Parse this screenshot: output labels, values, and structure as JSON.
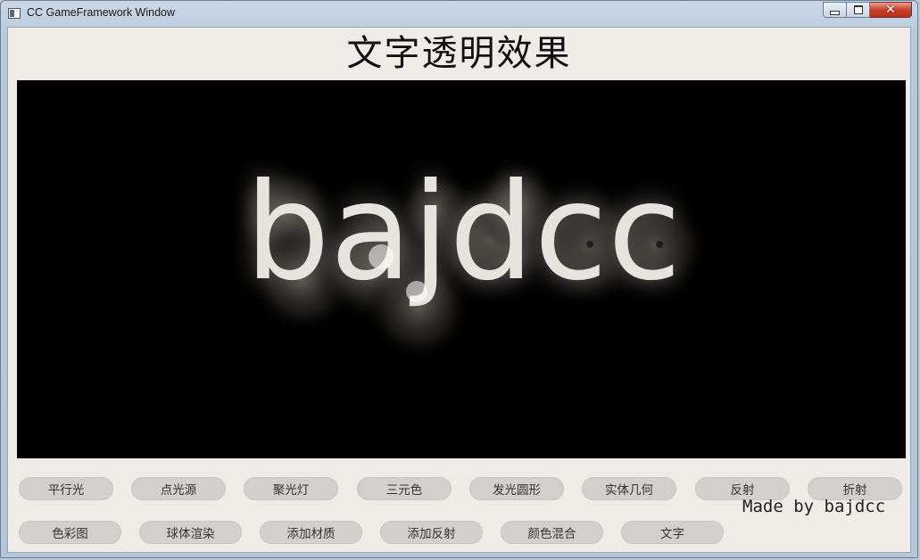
{
  "window": {
    "title": "CC GameFramework Window",
    "close_glyph": "✕"
  },
  "page": {
    "heading": "文字透明效果"
  },
  "canvas": {
    "text": "bajdcc",
    "background": "#000000",
    "text_color": "#e6e3dd"
  },
  "buttons": {
    "row1": [
      "平行光",
      "点光源",
      "聚光灯",
      "三元色",
      "发光圆形",
      "实体几何",
      "反射",
      "折射"
    ],
    "row2": [
      "色彩图",
      "球体渲染",
      "添加材质",
      "添加反射",
      "颜色混合",
      "文字"
    ]
  },
  "footer": {
    "made_by": "Made by bajdcc"
  },
  "colors": {
    "client_bg": "#efece7",
    "button_bg": "#d1d0cc",
    "close_button": "#c8412c"
  }
}
